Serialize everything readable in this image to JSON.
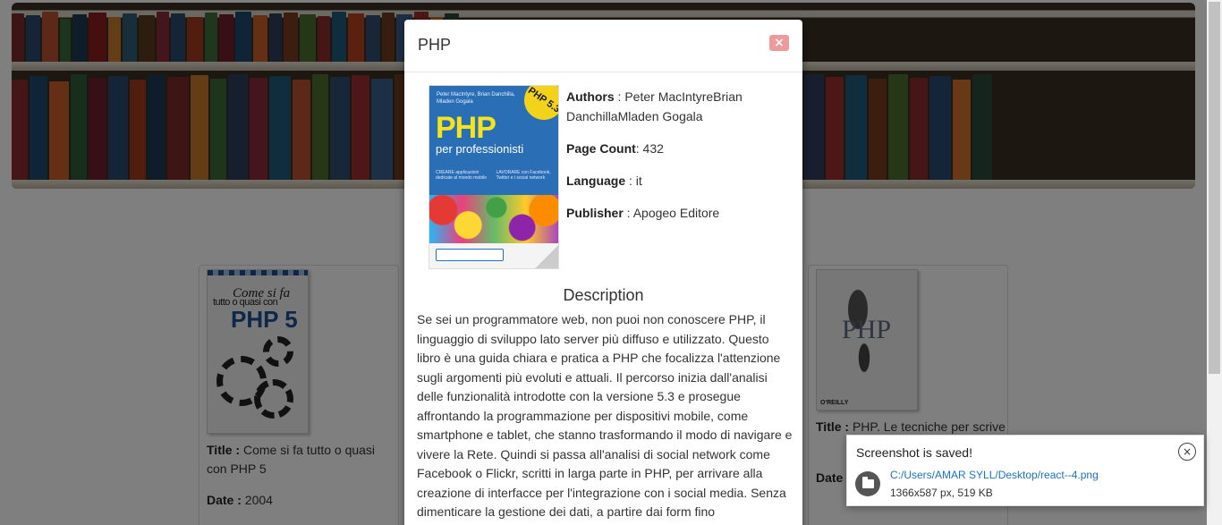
{
  "modal": {
    "title": "PHP",
    "close_label": "×",
    "cover": {
      "authors": "Peter MacIntyre, Brian Danchilla, Mladen Gogala",
      "badge": "PHP 5.3",
      "title": "PHP",
      "subtitle": "per professionisti",
      "col_left": "CREARE applicazioni dedicate al mondo mobile",
      "col_right": "LAVORARE con Facebook, Twitter e i social network"
    },
    "meta": {
      "authors_label": "Authors",
      "authors_value": " : Peter MacIntyreBrian DanchillaMladen Gogala",
      "page_count_label": "Page Count",
      "page_count_value": ": 432",
      "language_label": "Language",
      "language_value": " : it",
      "publisher_label": "Publisher",
      "publisher_value": " : Apogeo Editore"
    },
    "description_title": "Description",
    "description": "Se sei un programmatore web, non puoi non conoscere PHP, il linguaggio di sviluppo lato server più diffuso e utilizzato. Questo libro è una guida chiara e pratica a PHP che focalizza l'attenzione sugli argomenti più evoluti e attuali. Il percorso inizia dall'analisi delle funzionalità introdotte con la versione 5.3 e prosegue affrontando la programmazione per dispositivi mobile, come smartphone e tablet, che stanno trasformando il modo di navigare e vivere la Rete. Quindi si passa all'analisi di social network come Facebook o Flickr, scritti in larga parte in PHP, per arrivare alla creazione di interfacce per l'integrazione con i social media. Senza dimenticare la gestione dei dati, a partire dai form fino all'interazione"
  },
  "cards": [
    {
      "cover_line1": "Come si fa",
      "cover_line2": "tutto o quasi con",
      "cover_line3": "PHP 5",
      "title_label": "Title :",
      "title_value": " Come si fa tutto o quasi con PHP 5",
      "date_label": "Date :",
      "date_value": " 2004"
    },
    {
      "cover_title": "PHP",
      "cover_publisher": "O'REILLY",
      "title_label": "Title :",
      "title_value": " PHP. Le tecniche per scrive",
      "date_label": "Date"
    }
  ],
  "toast": {
    "title": "Screenshot is saved!",
    "close_label": "×",
    "path": "C:/Users/AMAR SYLL/Desktop/react--4.png",
    "meta": "1366x587 px, 519 KB"
  },
  "colors": {
    "close_button": "#ef9a9a",
    "link": "#1a73c8",
    "overlay": "rgba(0,0,0,0.5)"
  }
}
